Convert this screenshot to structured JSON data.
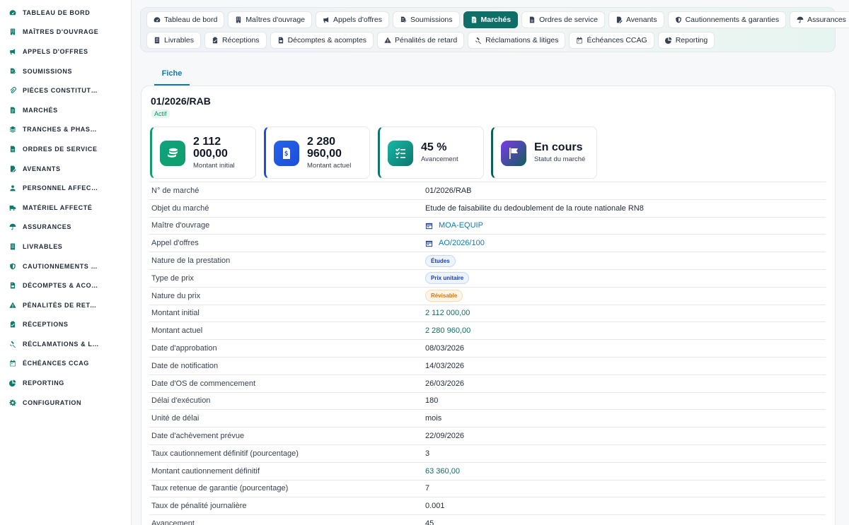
{
  "sidebar": {
    "items": [
      {
        "label": "TABLEAU DE BORD",
        "icon": "dashboard-icon"
      },
      {
        "label": "MAÎTRES D'OUVRAGE",
        "icon": "building-icon"
      },
      {
        "label": "APPELS D'OFFRES",
        "icon": "megaphone-icon"
      },
      {
        "label": "SOUMISSIONS",
        "icon": "file-signature-icon"
      },
      {
        "label": "PIÈCES CONSTITUTIVES",
        "icon": "paperclip-icon"
      },
      {
        "label": "MARCHÉS",
        "icon": "file-contract-icon"
      },
      {
        "label": "TRANCHES & PHASES",
        "icon": "layers-icon"
      },
      {
        "label": "ORDRES DE SERVICE",
        "icon": "file-icon"
      },
      {
        "label": "AVENANTS",
        "icon": "file-edit-icon"
      },
      {
        "label": "PERSONNEL AFFECTÉ",
        "icon": "user-icon"
      },
      {
        "label": "MATÉRIEL AFFECTÉ",
        "icon": "truck-icon"
      },
      {
        "label": "ASSURANCES",
        "icon": "umbrella-icon"
      },
      {
        "label": "LIVRABLES",
        "icon": "file-lines-icon"
      },
      {
        "label": "CAUTIONNEMENTS & GARANTIES",
        "icon": "shield-icon"
      },
      {
        "label": "DÉCOMPTES & ACOMPTES",
        "icon": "file-invoice-icon"
      },
      {
        "label": "PÉNALITÉS DE RETARD",
        "icon": "warning-icon"
      },
      {
        "label": "RÉCEPTIONS",
        "icon": "clipboard-check-icon"
      },
      {
        "label": "RÉCLAMATIONS & LITIGES",
        "icon": "gavel-icon"
      },
      {
        "label": "ÉCHÉANCES CCAG",
        "icon": "calendar-icon"
      },
      {
        "label": "REPORTING",
        "icon": "chart-pie-icon"
      },
      {
        "label": "CONFIGURATION",
        "icon": "gear-icon"
      }
    ]
  },
  "topnav": {
    "row1": [
      {
        "label": "Tableau de bord",
        "icon": "dashboard-icon"
      },
      {
        "label": "Maîtres d'ouvrage",
        "icon": "building-icon"
      },
      {
        "label": "Appels d'offres",
        "icon": "megaphone-icon"
      },
      {
        "label": "Soumissions",
        "icon": "file-signature-icon"
      },
      {
        "label": "Marchés",
        "icon": "file-contract-icon",
        "active": true
      },
      {
        "label": "Ordres de service",
        "icon": "file-icon"
      },
      {
        "label": "Avenants",
        "icon": "file-edit-icon"
      },
      {
        "label": "Cautionnements & garanties",
        "icon": "shield-icon"
      },
      {
        "label": "Assurances",
        "icon": "umbrella-icon"
      }
    ],
    "row2": [
      {
        "label": "Livrables",
        "icon": "file-lines-icon"
      },
      {
        "label": "Réceptions",
        "icon": "clipboard-check-icon"
      },
      {
        "label": "Décomptes & acomptes",
        "icon": "file-invoice-icon"
      },
      {
        "label": "Pénalités de retard",
        "icon": "warning-icon"
      },
      {
        "label": "Réclamations & litiges",
        "icon": "gavel-icon"
      },
      {
        "label": "Échéances CCAG",
        "icon": "calendar-icon"
      },
      {
        "label": "Reporting",
        "icon": "chart-pie-icon"
      }
    ]
  },
  "subtab": {
    "label": "Fiche"
  },
  "marche": {
    "reference": "01/2026/RAB",
    "statut_badge": "Actif"
  },
  "kpis": [
    {
      "value": "2 112 000,00",
      "label": "Montant initial",
      "color": "#10a37f",
      "accent": "#0f9d6b",
      "icon": "coins-icon"
    },
    {
      "value": "2 280 960,00",
      "label": "Montant actuel",
      "color": "#2563eb",
      "accent": "#1d4ed8",
      "icon": "file-dollar-icon"
    },
    {
      "value": "45 %",
      "label": "Avancement",
      "color": "#14b8a6",
      "accent": "#0f766e",
      "icon": "list-check-icon"
    },
    {
      "value": "En cours",
      "label": "Statut du marché",
      "color": "#7c3aed",
      "accent": "#115e59",
      "icon": "flag-icon"
    }
  ],
  "details": [
    {
      "label": "N° de marché",
      "value": "01/2026/RAB",
      "type": "text"
    },
    {
      "label": "Objet du marché",
      "value": "Etude de faisabilite du dedoublement de la route nationale RN8",
      "type": "text"
    },
    {
      "label": "Maître d'ouvrage",
      "value": "MOA-EQUIP",
      "type": "link"
    },
    {
      "label": "Appel d'offres",
      "value": "AO/2026/100",
      "type": "link"
    },
    {
      "label": "Nature de la prestation",
      "value": "Études",
      "type": "pill-blue"
    },
    {
      "label": "Type de prix",
      "value": "Prix unitaire",
      "type": "pill-blue"
    },
    {
      "label": "Nature du prix",
      "value": "Révisable",
      "type": "pill-orange"
    },
    {
      "label": "Montant initial",
      "value": "2 112 000,00",
      "type": "money"
    },
    {
      "label": "Montant actuel",
      "value": "2 280 960,00",
      "type": "money"
    },
    {
      "label": "Date d'approbation",
      "value": "08/03/2026",
      "type": "text"
    },
    {
      "label": "Date de notification",
      "value": "14/03/2026",
      "type": "text"
    },
    {
      "label": "Date d'OS de commencement",
      "value": "26/03/2026",
      "type": "text"
    },
    {
      "label": "Délai d'exécution",
      "value": "180",
      "type": "text"
    },
    {
      "label": "Unité de délai",
      "value": "mois",
      "type": "text"
    },
    {
      "label": "Date d'achèvement prévue",
      "value": "22/09/2026",
      "type": "text"
    },
    {
      "label": "Taux cautionnement définitif (pourcentage)",
      "value": "3",
      "type": "text"
    },
    {
      "label": "Montant cautionnement définitif",
      "value": "63 360,00",
      "type": "money"
    },
    {
      "label": "Taux retenue de garantie (pourcentage)",
      "value": "7",
      "type": "text"
    },
    {
      "label": "Taux de pénalité journalière",
      "value": "0.001",
      "type": "text"
    },
    {
      "label": "Avancement",
      "value": "45",
      "type": "text"
    }
  ]
}
